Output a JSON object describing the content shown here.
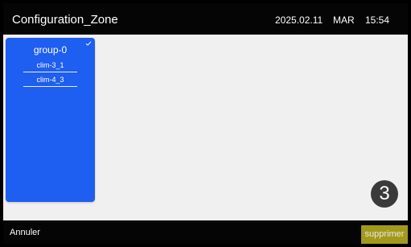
{
  "header": {
    "title": "Configuration_Zone",
    "date": "2025.02.11",
    "day": "MAR",
    "time": "15:54"
  },
  "groups": [
    {
      "name": "group-0",
      "selected": true,
      "color": "#1e5ef0",
      "items": [
        "clim-3_1",
        "clim-4_3"
      ]
    }
  ],
  "step_badge": "3",
  "footer": {
    "cancel_label": "Annuler",
    "delete_label": "supprimer",
    "delete_color": "#a39a1b"
  },
  "icons": {
    "group_selected": "check-icon"
  }
}
